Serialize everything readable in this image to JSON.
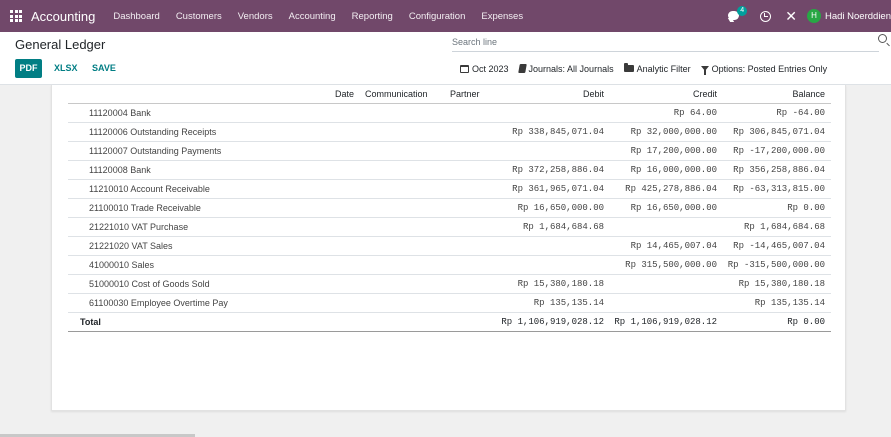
{
  "navbar": {
    "brand": "Accounting",
    "menu": [
      "Dashboard",
      "Customers",
      "Vendors",
      "Accounting",
      "Reporting",
      "Configuration",
      "Expenses"
    ],
    "chat_count": "4",
    "avatar_initial": "H",
    "user_name": "Hadi Noerddien"
  },
  "control": {
    "title": "General Ledger",
    "search_placeholder": "Search line",
    "pdf_label": "PDF",
    "xlsx_label": "XLSX",
    "save_label": "SAVE",
    "filters": {
      "date": "Oct 2023",
      "journals": "Journals: All Journals",
      "analytic": "Analytic Filter",
      "options": "Options: Posted Entries Only"
    }
  },
  "table": {
    "headers": {
      "account": "",
      "date": "Date",
      "communication": "Communication",
      "partner": "Partner",
      "debit": "Debit",
      "credit": "Credit",
      "balance": "Balance"
    },
    "rows": [
      {
        "account": "11120004 Bank",
        "debit": "",
        "credit": "Rp 64.00",
        "balance": "Rp -64.00",
        "negative": true
      },
      {
        "account": "11120006 Outstanding Receipts",
        "debit": "Rp 338,845,071.04",
        "credit": "Rp 32,000,000.00",
        "balance": "Rp 306,845,071.04",
        "negative": false
      },
      {
        "account": "11120007 Outstanding Payments",
        "debit": "",
        "credit": "Rp 17,200,000.00",
        "balance": "Rp -17,200,000.00",
        "negative": true
      },
      {
        "account": "11120008 Bank",
        "debit": "Rp 372,258,886.04",
        "credit": "Rp 16,000,000.00",
        "balance": "Rp 356,258,886.04",
        "negative": false
      },
      {
        "account": "11210010 Account Receivable",
        "debit": "Rp 361,965,071.04",
        "credit": "Rp 425,278,886.04",
        "balance": "Rp -63,313,815.00",
        "negative": true
      },
      {
        "account": "21100010 Trade Receivable",
        "debit": "Rp 16,650,000.00",
        "credit": "Rp 16,650,000.00",
        "balance": "Rp 0.00",
        "negative": false
      },
      {
        "account": "21221010 VAT Purchase",
        "debit": "Rp 1,684,684.68",
        "credit": "",
        "balance": "Rp 1,684,684.68",
        "negative": false
      },
      {
        "account": "21221020 VAT Sales",
        "debit": "",
        "credit": "Rp 14,465,007.04",
        "balance": "Rp -14,465,007.04",
        "negative": true
      },
      {
        "account": "41000010 Sales",
        "debit": "",
        "credit": "Rp 315,500,000.00",
        "balance": "Rp -315,500,000.00",
        "negative": true
      },
      {
        "account": "51000010 Cost of Goods Sold",
        "debit": "Rp 15,380,180.18",
        "credit": "",
        "balance": "Rp 15,380,180.18",
        "negative": false
      },
      {
        "account": "61100030 Employee Overtime Pay",
        "debit": "Rp 135,135.14",
        "credit": "",
        "balance": "Rp 135,135.14",
        "negative": false
      }
    ],
    "total": {
      "label": "Total",
      "debit": "Rp 1,106,919,028.12",
      "credit": "Rp 1,106,919,028.12",
      "balance": "Rp 0.00"
    }
  }
}
